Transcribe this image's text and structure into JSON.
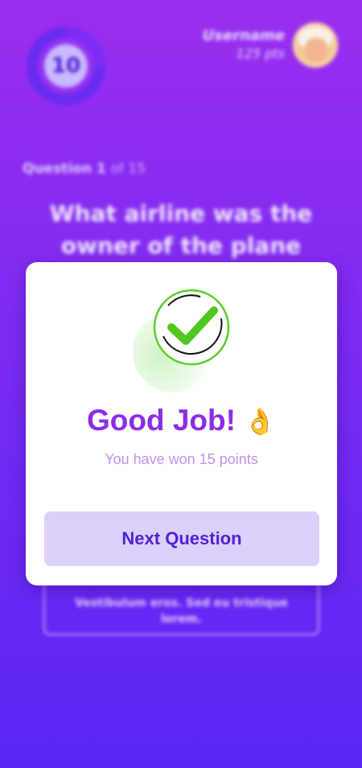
{
  "header": {
    "timer_value": "10",
    "username": "Username",
    "points": "125 pts"
  },
  "question": {
    "number_label": "Question 1",
    "of_label": "of 15",
    "text": "What airline was the owner of the plane"
  },
  "answers": [
    {
      "text": "Vestibulum eros. Sed eu tristique lorem."
    }
  ],
  "modal": {
    "title": "Good Job!",
    "title_emoji": "👌",
    "subtitle": "You have won 15 points",
    "next_button_label": "Next Question",
    "icon": "check-circle-icon",
    "icon_color": "#4fc71f"
  },
  "colors": {
    "background_top": "#9b2ef0",
    "background_bottom": "#5a25f5",
    "title": "#8a2ce8",
    "button_bg": "#ddd0fb",
    "button_text": "#4a23d4"
  }
}
